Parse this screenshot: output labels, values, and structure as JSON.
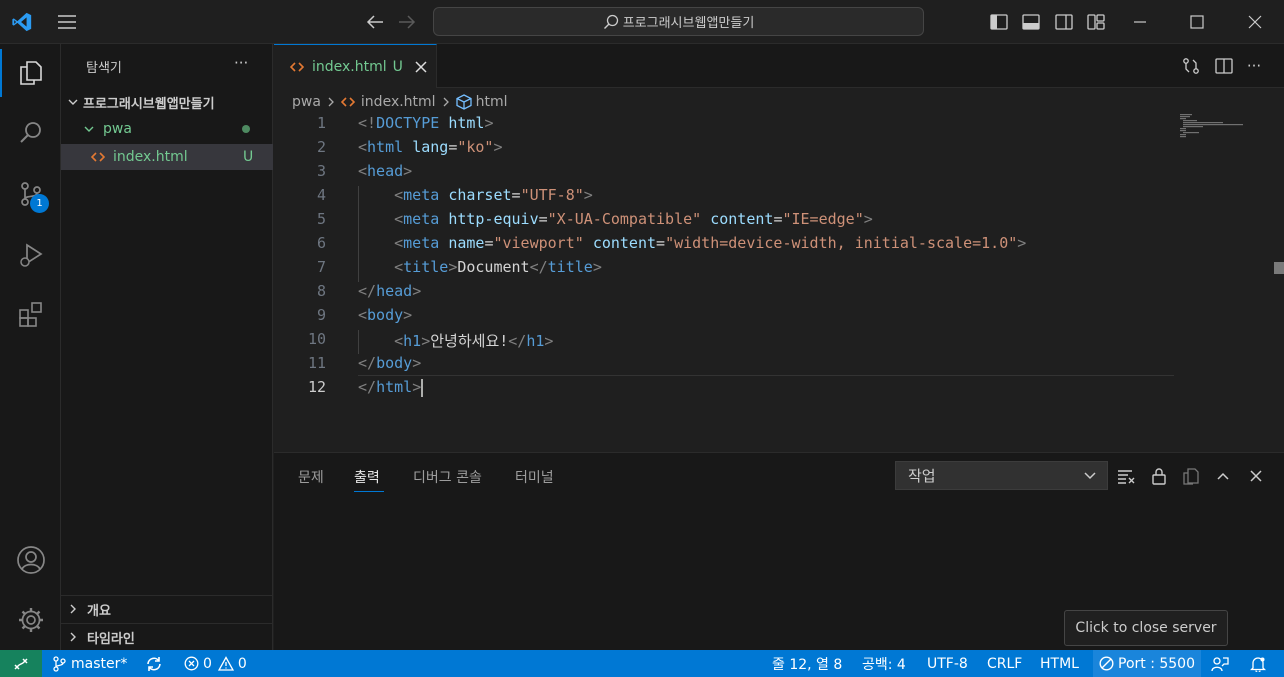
{
  "titlebar": {
    "search_text": "프로그래시브웹앱만들기"
  },
  "activity": {
    "scm_badge": "1"
  },
  "explorer": {
    "title": "탐색기",
    "more": "···",
    "root": "프로그래시브웹앱만들기",
    "folder": "pwa",
    "file": "index.html",
    "file_status": "U",
    "outline_label": "개요",
    "timeline_label": "타임라인"
  },
  "editor": {
    "tab_label": "index.html",
    "tab_status": "U",
    "breadcrumb": {
      "folder": "pwa",
      "file": "index.html",
      "symbol": "html"
    },
    "line_numbers": [
      "1",
      "2",
      "3",
      "4",
      "5",
      "6",
      "7",
      "8",
      "9",
      "10",
      "11",
      "12"
    ],
    "lines": [
      [
        {
          "c": "t",
          "v": "<!"
        },
        {
          "c": "g",
          "v": "DOCTYPE"
        },
        {
          "c": "p",
          "v": " "
        },
        {
          "c": "a",
          "v": "html"
        },
        {
          "c": "t",
          "v": ">"
        }
      ],
      [
        {
          "c": "t",
          "v": "<"
        },
        {
          "c": "g",
          "v": "html"
        },
        {
          "c": "p",
          "v": " "
        },
        {
          "c": "a",
          "v": "lang"
        },
        {
          "c": "p",
          "v": "="
        },
        {
          "c": "s",
          "v": "\"ko\""
        },
        {
          "c": "t",
          "v": ">"
        }
      ],
      [
        {
          "c": "t",
          "v": "<"
        },
        {
          "c": "g",
          "v": "head"
        },
        {
          "c": "t",
          "v": ">"
        }
      ],
      [
        {
          "c": "p",
          "v": "    "
        },
        {
          "c": "t",
          "v": "<"
        },
        {
          "c": "g",
          "v": "meta"
        },
        {
          "c": "p",
          "v": " "
        },
        {
          "c": "a",
          "v": "charset"
        },
        {
          "c": "p",
          "v": "="
        },
        {
          "c": "s",
          "v": "\"UTF-8\""
        },
        {
          "c": "t",
          "v": ">"
        }
      ],
      [
        {
          "c": "p",
          "v": "    "
        },
        {
          "c": "t",
          "v": "<"
        },
        {
          "c": "g",
          "v": "meta"
        },
        {
          "c": "p",
          "v": " "
        },
        {
          "c": "a",
          "v": "http-equiv"
        },
        {
          "c": "p",
          "v": "="
        },
        {
          "c": "s",
          "v": "\"X-UA-Compatible\""
        },
        {
          "c": "p",
          "v": " "
        },
        {
          "c": "a",
          "v": "content"
        },
        {
          "c": "p",
          "v": "="
        },
        {
          "c": "s",
          "v": "\"IE=edge\""
        },
        {
          "c": "t",
          "v": ">"
        }
      ],
      [
        {
          "c": "p",
          "v": "    "
        },
        {
          "c": "t",
          "v": "<"
        },
        {
          "c": "g",
          "v": "meta"
        },
        {
          "c": "p",
          "v": " "
        },
        {
          "c": "a",
          "v": "name"
        },
        {
          "c": "p",
          "v": "="
        },
        {
          "c": "s",
          "v": "\"viewport\""
        },
        {
          "c": "p",
          "v": " "
        },
        {
          "c": "a",
          "v": "content"
        },
        {
          "c": "p",
          "v": "="
        },
        {
          "c": "s",
          "v": "\"width=device-width, initial-scale=1.0\""
        },
        {
          "c": "t",
          "v": ">"
        }
      ],
      [
        {
          "c": "p",
          "v": "    "
        },
        {
          "c": "t",
          "v": "<"
        },
        {
          "c": "g",
          "v": "title"
        },
        {
          "c": "t",
          "v": ">"
        },
        {
          "c": "p",
          "v": "Document"
        },
        {
          "c": "t",
          "v": "</"
        },
        {
          "c": "g",
          "v": "title"
        },
        {
          "c": "t",
          "v": ">"
        }
      ],
      [
        {
          "c": "t",
          "v": "</"
        },
        {
          "c": "g",
          "v": "head"
        },
        {
          "c": "t",
          "v": ">"
        }
      ],
      [
        {
          "c": "t",
          "v": "<"
        },
        {
          "c": "g",
          "v": "body"
        },
        {
          "c": "t",
          "v": ">"
        }
      ],
      [
        {
          "c": "p",
          "v": "    "
        },
        {
          "c": "t",
          "v": "<"
        },
        {
          "c": "g",
          "v": "h1"
        },
        {
          "c": "t",
          "v": ">"
        },
        {
          "c": "p",
          "v": "안녕하세요!"
        },
        {
          "c": "t",
          "v": "</"
        },
        {
          "c": "g",
          "v": "h1"
        },
        {
          "c": "t",
          "v": ">"
        }
      ],
      [
        {
          "c": "t",
          "v": "</"
        },
        {
          "c": "g",
          "v": "body"
        },
        {
          "c": "t",
          "v": ">"
        }
      ],
      [
        {
          "c": "t",
          "v": "</"
        },
        {
          "c": "g",
          "v": "html"
        },
        {
          "c": "t",
          "v": ">"
        }
      ]
    ],
    "active_line": 12
  },
  "panel": {
    "tabs": [
      "문제",
      "출력",
      "디버그 콘솔",
      "터미널"
    ],
    "active_tab": "출력",
    "output_select": "작업"
  },
  "statusbar": {
    "branch": "master*",
    "errors": "0",
    "warnings": "0",
    "position": "줄 12, 열 8",
    "spaces": "공백: 4",
    "encoding": "UTF-8",
    "eol": "CRLF",
    "language": "HTML",
    "port": "Port : 5500"
  },
  "tooltip": {
    "text": "Click to close server"
  },
  "colors": {
    "accent": "#0078d4",
    "untracked": "#73c991",
    "html_icon": "#e37933"
  }
}
